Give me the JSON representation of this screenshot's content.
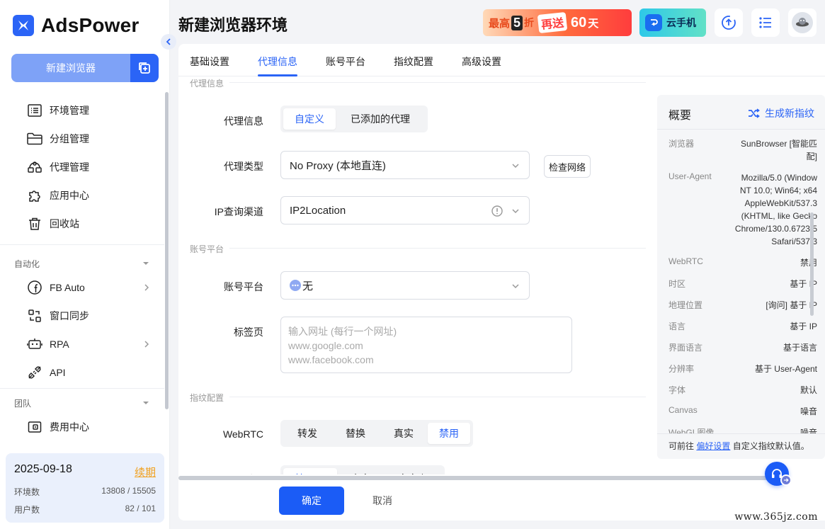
{
  "app": {
    "name": "AdsPower"
  },
  "sidebar": {
    "new_browser": "新建浏览器",
    "items": [
      {
        "label": "环境管理",
        "icon": "list-icon"
      },
      {
        "label": "分组管理",
        "icon": "folder-icon"
      },
      {
        "label": "代理管理",
        "icon": "proxy-icon"
      },
      {
        "label": "应用中心",
        "icon": "puzzle-icon"
      },
      {
        "label": "回收站",
        "icon": "trash-icon"
      }
    ],
    "groups": {
      "automation": "自动化",
      "team": "团队"
    },
    "automation_items": [
      {
        "label": "FB Auto",
        "icon": "facebook-icon"
      },
      {
        "label": "窗口同步",
        "icon": "window-sync-icon"
      },
      {
        "label": "RPA",
        "icon": "robot-icon"
      },
      {
        "label": "API",
        "icon": "plug-icon"
      }
    ],
    "team_items": [
      {
        "label": "费用中心",
        "icon": "wallet-icon"
      }
    ],
    "account": {
      "expiry": "2025-09-18",
      "renew": "续期",
      "env_count_label": "环境数",
      "env_count_value": "13808 / 15505",
      "user_count_label": "用户数",
      "user_count_value": "82 / 101"
    }
  },
  "header": {
    "title": "新建浏览器环境",
    "promo": {
      "a": "最高",
      "b": "5",
      "c": "折",
      "d": "再送",
      "e": "60",
      "f": "天"
    },
    "cloud_phone": "云手机"
  },
  "tabs": [
    "基础设置",
    "代理信息",
    "账号平台",
    "指纹配置",
    "高级设置"
  ],
  "active_tab": 1,
  "form": {
    "section_proxy": "代理信息",
    "proxy_info_label": "代理信息",
    "proxy_info_options": [
      "自定义",
      "已添加的代理"
    ],
    "proxy_type_label": "代理类型",
    "proxy_type_value": "No Proxy (本地直连)",
    "check_network": "检查网络",
    "ip_channel_label": "IP查询渠道",
    "ip_channel_value": "IP2Location",
    "section_account": "账号平台",
    "account_platform_label": "账号平台",
    "account_platform_value": "无",
    "tabs_label": "标签页",
    "tabs_placeholder": "输入网址 (每行一个网址)\nwww.google.com\nwww.facebook.com",
    "section_fingerprint": "指纹配置",
    "webrtc_label": "WebRTC",
    "webrtc_options": [
      "转发",
      "替换",
      "真实",
      "禁用"
    ],
    "webrtc_selected": 3,
    "timezone_label": "时区",
    "timezone_options": [
      "基于 IP",
      "真实",
      "自定义"
    ]
  },
  "actions": {
    "ok": "确定",
    "cancel": "取消"
  },
  "overview": {
    "title": "概要",
    "generate": "生成新指纹",
    "rows": [
      {
        "key": "浏览器",
        "value": "SunBrowser [智能匹\n配]"
      },
      {
        "key": "User-Agent",
        "value": "Mozilla/5.0 (Window\nNT 10.0; Win64; x64\nAppleWebKit/537.3\n(KHTML, like Gecko\nChrome/130.0.6723.5\nSafari/537.3"
      },
      {
        "key": "WebRTC",
        "value": "禁用"
      },
      {
        "key": "时区",
        "value": "基于 IP"
      },
      {
        "key": "地理位置",
        "value": "[询问] 基于 IP"
      },
      {
        "key": "语言",
        "value": "基于 IP"
      },
      {
        "key": "界面语言",
        "value": "基于语言"
      },
      {
        "key": "分辨率",
        "value": "基于 User-Agent"
      },
      {
        "key": "字体",
        "value": "默认"
      },
      {
        "key": "Canvas",
        "value": "噪音"
      },
      {
        "key": "WebGL图像",
        "value": "噪音"
      }
    ],
    "footer_prefix": "可前往",
    "footer_link": "偏好设置",
    "footer_suffix": "自定义指纹默认值。"
  },
  "watermark": "www.365jz.com",
  "colors": {
    "accent": "#2b64f6",
    "renew": "#f0a01e"
  }
}
